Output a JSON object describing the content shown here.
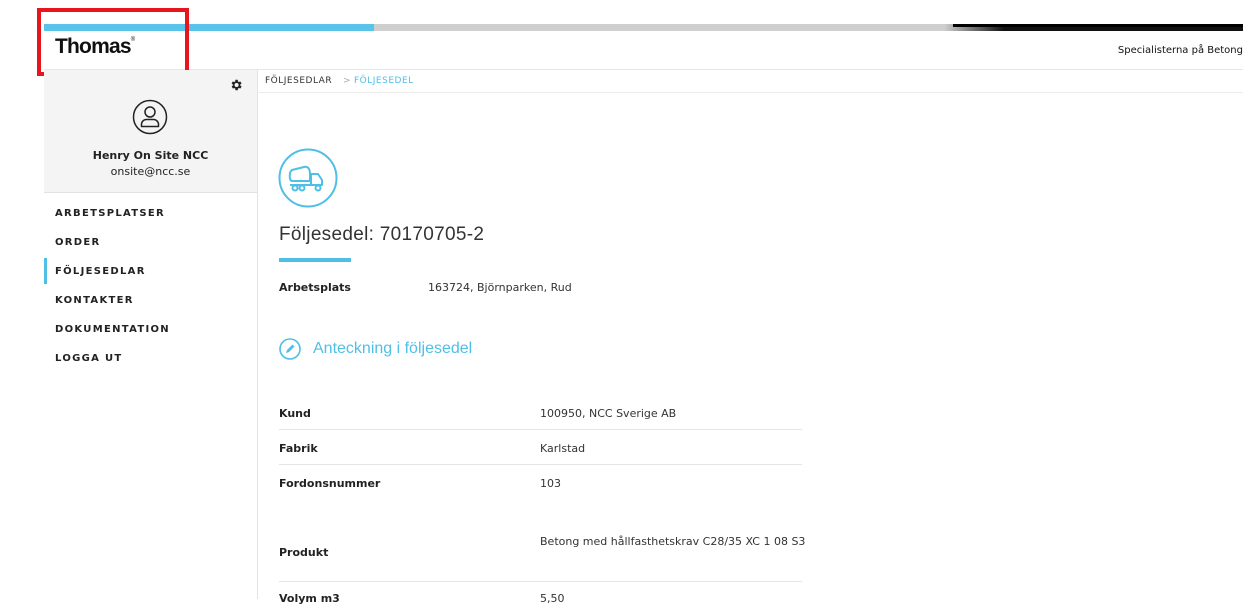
{
  "header": {
    "logo": "Thomas",
    "logo_mark": "®",
    "tagline": "Specialisterna på Betong"
  },
  "sidebar": {
    "user_name": "Henry On Site NCC",
    "user_email": "onsite@ncc.se",
    "items": [
      {
        "label": "ARBETSPLATSER"
      },
      {
        "label": "ORDER"
      },
      {
        "label": "FÖLJESEDLAR",
        "active": true
      },
      {
        "label": "KONTAKTER"
      },
      {
        "label": "DOKUMENTATION"
      },
      {
        "label": "LOGGA UT"
      }
    ]
  },
  "breadcrumb": {
    "parent": "FÖLJESEDLAR",
    "separator": ">",
    "current": "FÖLJESEDEL"
  },
  "main": {
    "title": "Följesedel: 70170705-2",
    "arbetsplats_label": "Arbetsplats",
    "arbetsplats_value": "163724, Björnparken, Rud",
    "note_link": "Anteckning i följesedel",
    "details": [
      {
        "label": "Kund",
        "value": "100950, NCC Sverige AB"
      },
      {
        "label": "Fabrik",
        "value": "Karlstad"
      },
      {
        "label": "Fordonsnummer",
        "value": "103"
      },
      {
        "label": "Produkt",
        "value": "Betong med hållfasthetskrav C28/35 XC 1 08 S3"
      },
      {
        "label": "Volym m3",
        "value": "5,50"
      }
    ]
  },
  "colors": {
    "accent": "#4fbfe6",
    "highlight": "#e8161c"
  },
  "icons": [
    "gear-icon",
    "user-avatar-icon",
    "concrete-truck-icon",
    "pencil-icon"
  ]
}
